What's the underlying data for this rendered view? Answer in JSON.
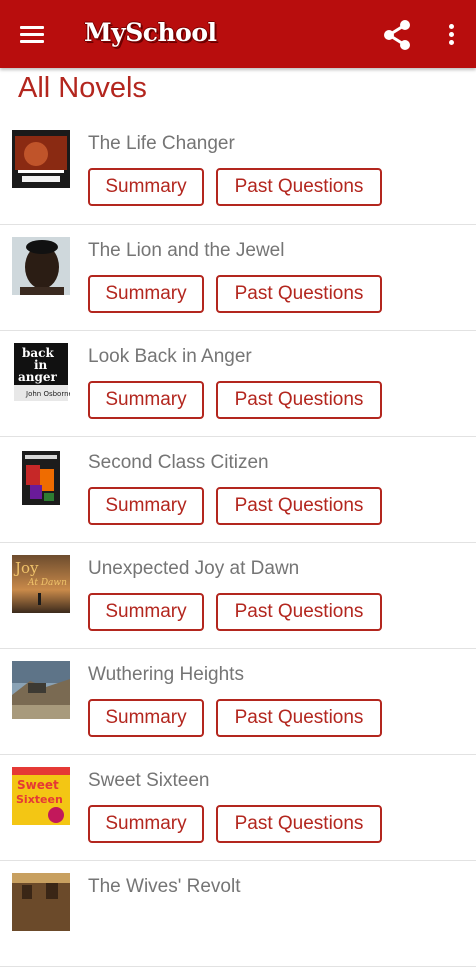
{
  "appbar": {
    "logo_text": "MySchool",
    "background": "#b80d0d",
    "icons": [
      "menu-icon",
      "share-icon",
      "more-vert-icon"
    ]
  },
  "page": {
    "title": "All Novels"
  },
  "novels": [
    {
      "title": "The Life Changer",
      "summary_label": "Summary",
      "past_label": "Past Questions"
    },
    {
      "title": "The Lion and the Jewel",
      "summary_label": "Summary",
      "past_label": "Past Questions"
    },
    {
      "title": "Look Back in Anger",
      "summary_label": "Summary",
      "past_label": "Past Questions",
      "cover_text": [
        "back",
        "in",
        "anger",
        "John Osborne"
      ]
    },
    {
      "title": "Second Class Citizen",
      "summary_label": "Summary",
      "past_label": "Past Questions"
    },
    {
      "title": "Unexpected Joy at Dawn",
      "summary_label": "Summary",
      "past_label": "Past Questions",
      "cover_text": [
        "Joy",
        "At Dawn"
      ]
    },
    {
      "title": "Wuthering Heights",
      "summary_label": "Summary",
      "past_label": "Past Questions"
    },
    {
      "title": "Sweet Sixteen",
      "summary_label": "Summary",
      "past_label": "Past Questions",
      "cover_text": [
        "Sweet",
        "Sixteen"
      ]
    },
    {
      "title": "The Wives' Revolt"
    }
  ],
  "colors": {
    "accent": "#b3261e",
    "title_gray": "#757575",
    "divider": "#e2e2e2"
  }
}
